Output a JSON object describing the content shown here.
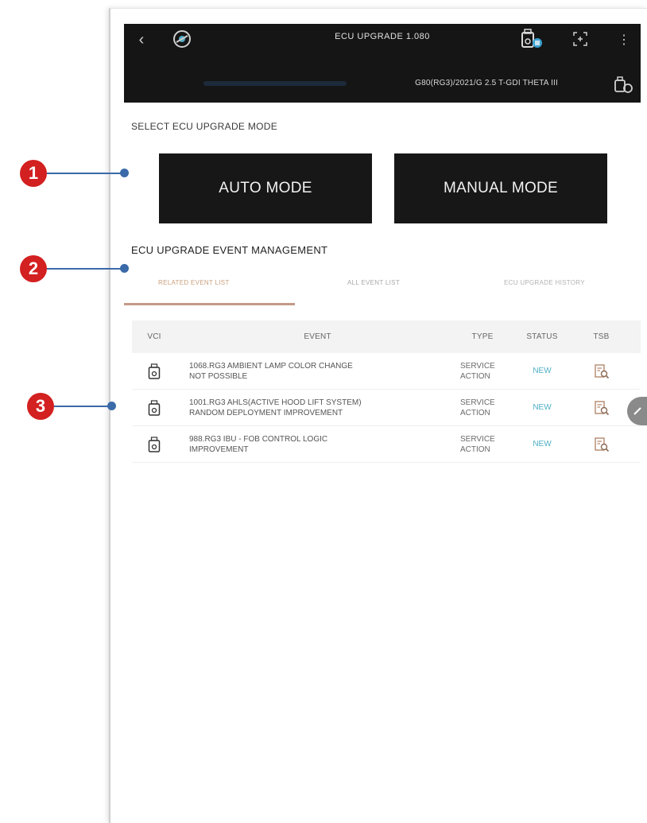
{
  "header": {
    "back_glyph": "‹",
    "title": "ECU UPGRADE 1.080",
    "more_glyph": "⋮",
    "vehicle": "G80(RG3)/2021/G 2.5 T-GDI THETA III",
    "icons": [
      "back-icon",
      "logo-icon",
      "vci-icon",
      "screen-capture-icon",
      "more-icon",
      "car-icon"
    ]
  },
  "mode_section": {
    "title": "SELECT ECU UPGRADE MODE",
    "auto_label": "AUTO MODE",
    "manual_label": "MANUAL MODE"
  },
  "event_section": {
    "title": "ECU UPGRADE EVENT MANAGEMENT",
    "tabs": [
      {
        "label": "RELATED EVENT LIST",
        "active": true
      },
      {
        "label": "ALL EVENT LIST",
        "active": false
      },
      {
        "label": "ECU UPGRADE HISTORY",
        "active": false
      }
    ]
  },
  "table": {
    "columns": [
      "VCI",
      "EVENT",
      "TYPE",
      "STATUS",
      "TSB"
    ],
    "rows": [
      {
        "event_line1": "1068.RG3 AMBIENT LAMP COLOR CHANGE",
        "event_line2": "NOT POSSIBLE",
        "type_line1": "SERVICE",
        "type_line2": "ACTION",
        "status": "NEW"
      },
      {
        "event_line1": "1001.RG3 AHLS(ACTIVE HOOD LIFT SYSTEM)",
        "event_line2": "RANDOM DEPLOYMENT IMPROVEMENT",
        "type_line1": "SERVICE",
        "type_line2": "ACTION",
        "status": "NEW"
      },
      {
        "event_line1": "988.RG3 IBU - FOB CONTROL LOGIC",
        "event_line2": "IMPROVEMENT",
        "type_line1": "SERVICE",
        "type_line2": "ACTION",
        "status": "NEW"
      }
    ]
  },
  "callouts": [
    "1",
    "2",
    "3"
  ],
  "colors": {
    "header_bg": "#151515",
    "button_bg": "#171717",
    "active_tab": "#c9a07e",
    "tab_underline": "#c39a88",
    "status_new": "#4fb0c6",
    "callout_badge": "#d32020",
    "callout_line": "#3a6aa8"
  }
}
